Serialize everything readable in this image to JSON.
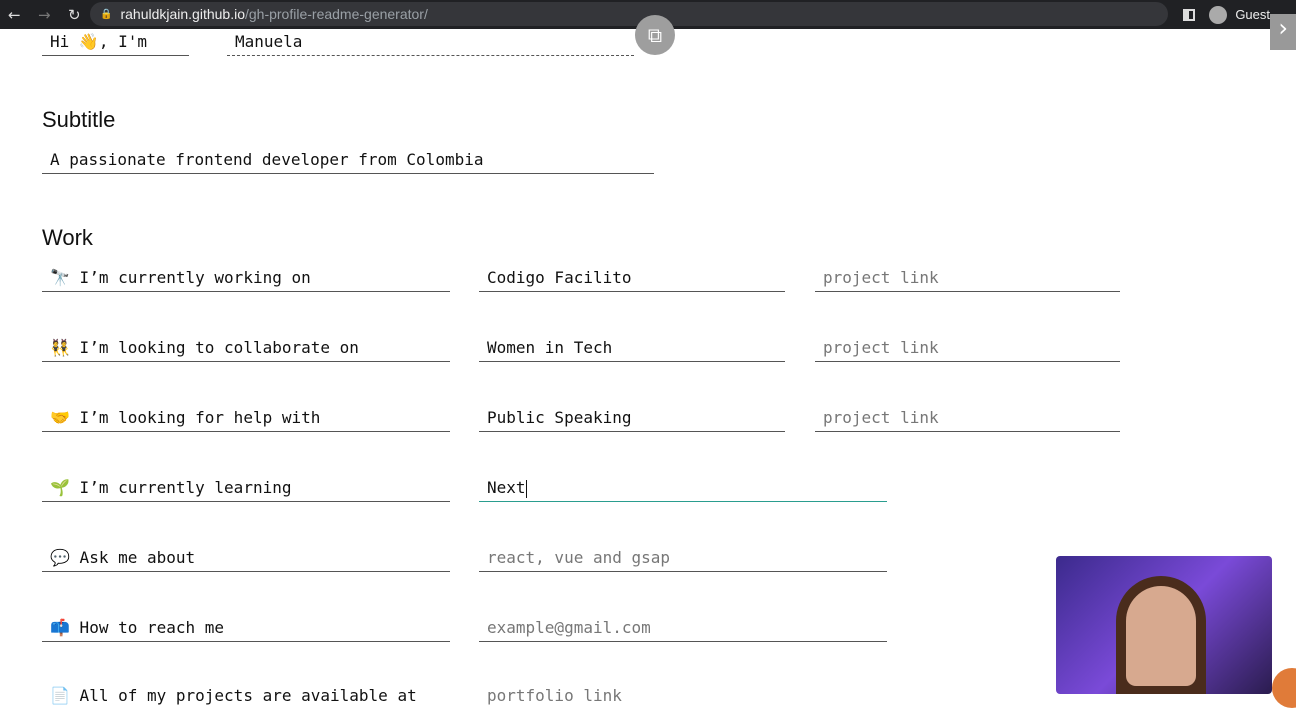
{
  "browser": {
    "url_host": "rahuldkjain.github.io",
    "url_path": "/gh-profile-readme-generator/",
    "profile": "Guest"
  },
  "title": {
    "prefix": "Hi 👋, I'm",
    "name": "Manuela"
  },
  "subtitle": {
    "heading": "Subtitle",
    "value": "A passionate frontend developer from Colombia"
  },
  "work": {
    "heading": "Work",
    "rows": [
      {
        "label": "🔭 I’m currently working on",
        "value": "Codigo Facilito",
        "link_placeholder": "project link"
      },
      {
        "label": "👯 I’m looking to collaborate on",
        "value": "Women in Tech",
        "link_placeholder": "project link"
      },
      {
        "label": "🤝 I’m looking for help with",
        "value": "Public Speaking",
        "link_placeholder": "project link"
      },
      {
        "label": "🌱 I’m currently learning",
        "value": "Next"
      },
      {
        "label": "💬 Ask me about",
        "placeholder": "react, vue and gsap"
      },
      {
        "label": "📫 How to reach me",
        "placeholder": "example@gmail.com"
      },
      {
        "label": "📄 All of my projects are available at",
        "placeholder": "portfolio link"
      }
    ]
  }
}
